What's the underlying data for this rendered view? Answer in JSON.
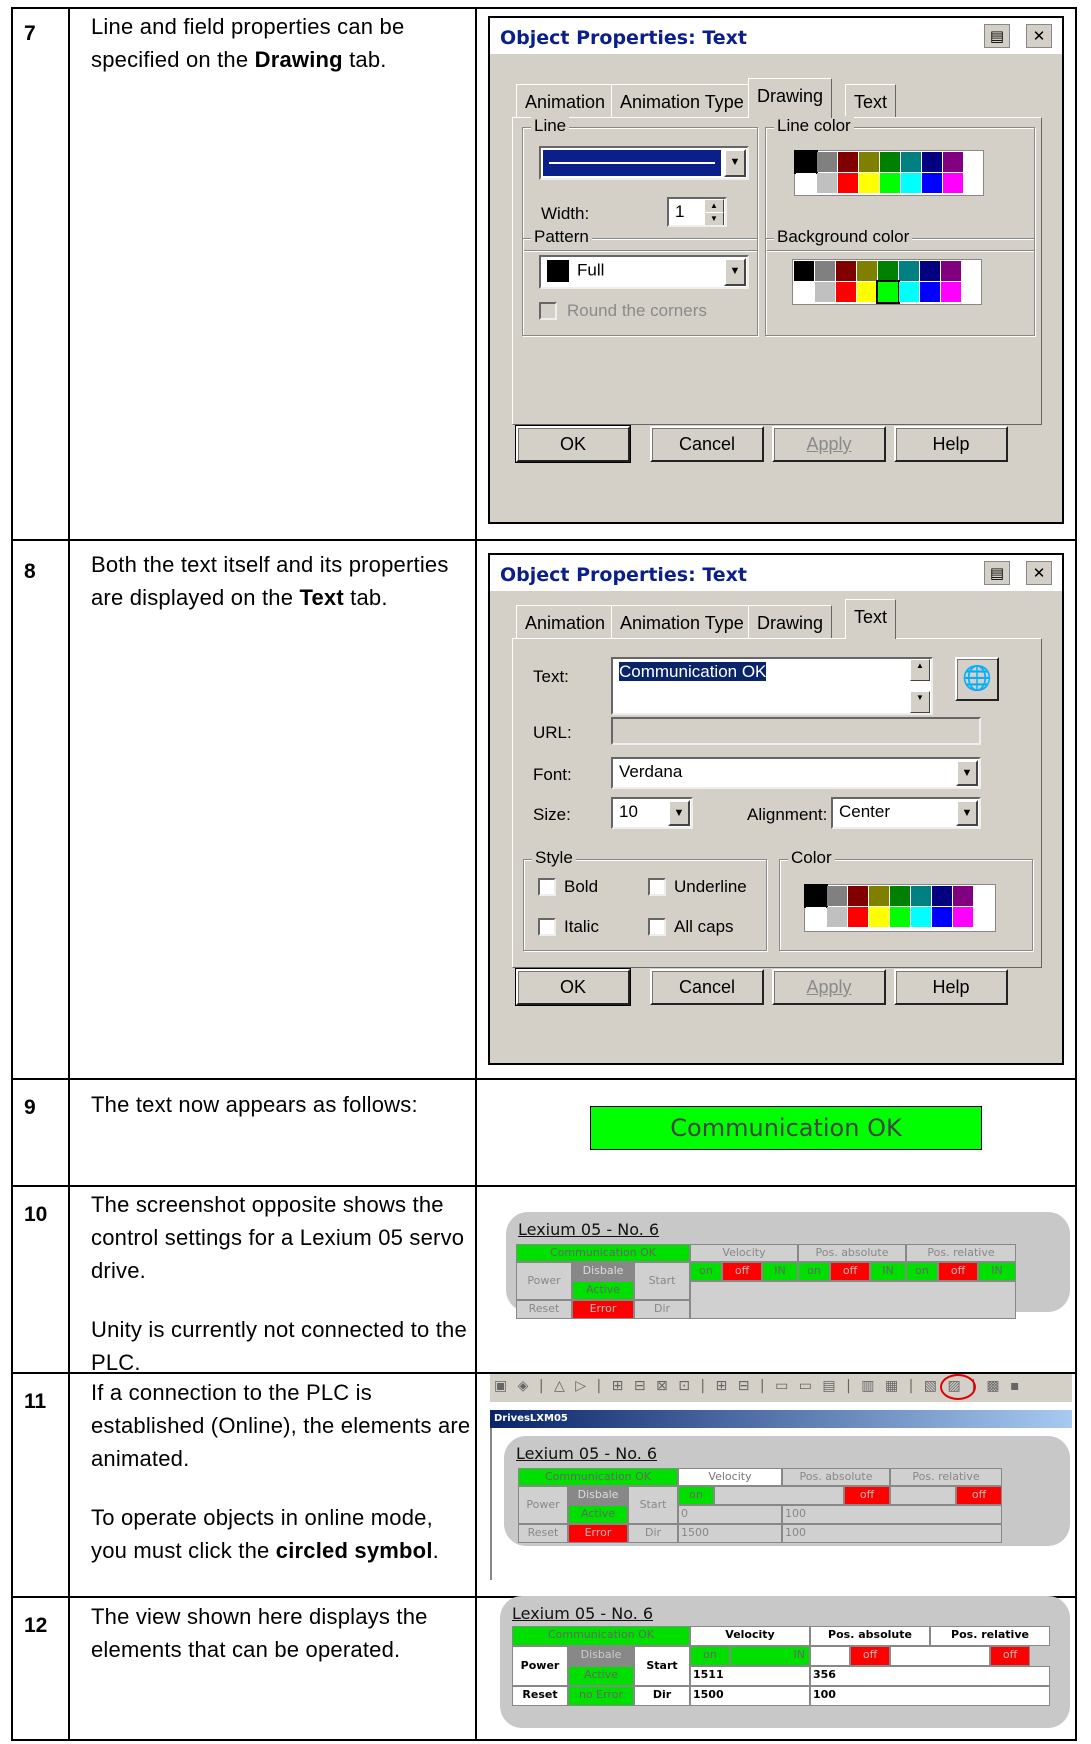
{
  "rows": [
    {
      "num": "7",
      "text_html": "Line and field properties can be specified on the <b>Drawing</b> tab."
    },
    {
      "num": "8",
      "text_html": "Both the text itself and its properties are displayed on the <b>Text</b> tab."
    },
    {
      "num": "9",
      "text_html": "The text now appears as follows:"
    },
    {
      "num": "10",
      "text_html": "<p>The screenshot opposite shows the control settings for a Lexium 05 servo drive.</p><p style=\"margin-top:26px\">Unity is currently not connected to the PLC.</p>"
    },
    {
      "num": "11",
      "text_html": "<p>If a connection to the PLC is established (Online), the elements are animated.</p><p style=\"margin-top:26px\">To operate objects in online mode, you must click the <b>circled symbol</b>.</p>"
    },
    {
      "num": "12",
      "text_html": "The view shown here displays the elements that can be operated."
    }
  ],
  "dialog": {
    "title": "Object Properties: Text",
    "tabs": [
      "Animation",
      "Animation Type",
      "Drawing",
      "Text"
    ],
    "buttons": {
      "ok": "OK",
      "cancel": "Cancel",
      "apply": "Apply",
      "help": "Help"
    }
  },
  "drawing_tab": {
    "line_group": "Line",
    "width_label": "Width:",
    "width_value": "1",
    "line_color_group": "Line color",
    "pattern_group": "Pattern",
    "pattern_value": "Full",
    "round_corners": "Round the corners",
    "background_color_group": "Background color"
  },
  "text_tab": {
    "text_label": "Text:",
    "text_value": "Communication OK",
    "url_label": "URL:",
    "font_label": "Font:",
    "font_value": "Verdana",
    "size_label": "Size:",
    "size_value": "10",
    "alignment_label": "Alignment:",
    "alignment_value": "Center",
    "style_group": "Style",
    "bold": "Bold",
    "underline": "Underline",
    "italic": "Italic",
    "all_caps": "All caps",
    "color_group": "Color"
  },
  "preview_text": "Communication OK",
  "palette_top": [
    "#000000",
    "#808080",
    "#800000",
    "#808000",
    "#008000",
    "#008080",
    "#000080",
    "#800080"
  ],
  "palette_bottom": [
    "#ffffff",
    "#c0c0c0",
    "#ff0000",
    "#ffff00",
    "#00ff00",
    "#00ffff",
    "#0000ff",
    "#ff00ff"
  ],
  "lexium": {
    "title": "Lexium 05  -  No. 6",
    "comm": "Communication OK",
    "power": "Power",
    "reset": "Reset",
    "disable": "Disbale",
    "active": "Active",
    "error": "Error",
    "no_error": "no Error",
    "start": "Start",
    "dir": "Dir",
    "velocity": "Velocity",
    "pos_abs": "Pos. absolute",
    "pos_rel": "Pos. relative",
    "on": "on",
    "off": "off",
    "in": "IN",
    "online_vals": {
      "v1": "0",
      "p1": "100",
      "v2": "1500",
      "p2": "100"
    },
    "op_vals": {
      "v1": "1511",
      "p1": "356",
      "v2": "1500",
      "p2": "100"
    }
  },
  "app_window_title": "DrivesLXM05"
}
